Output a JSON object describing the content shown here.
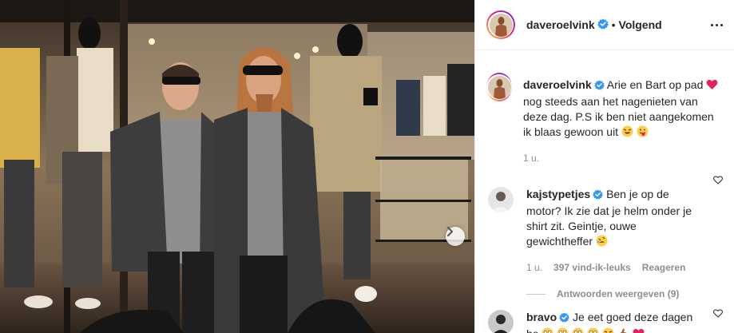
{
  "header": {
    "username": "daveroelvink",
    "separator": "•",
    "follow_label": "Volgend"
  },
  "caption": {
    "username": "daveroelvink",
    "text_part1": "Arie en Bart op pad",
    "text_part2": "nog steeds aan het nagenieten van deze dag. P.S ik ben niet aangekomen ik blaas gewoon uit",
    "time": "1 u."
  },
  "comments": [
    {
      "username": "kajstypetjes",
      "text": "Ben je op de motor? Ik zie dat je helm onder je shirt zit. Geintje, ouwe gewichtheffer",
      "time": "1 u.",
      "likes": "397 vind-ik-leuks",
      "reply_label": "Reageren",
      "view_replies": "Antwoorden weergeven (9)"
    },
    {
      "username": "bravo",
      "text": "Je eet goed deze dagen he"
    }
  ],
  "icons": {
    "verified": "verified-badge-icon",
    "more": "more-options-icon",
    "like": "heart-outline-icon",
    "next": "chevron-right-icon"
  },
  "colors": {
    "verified_blue": "#3897f0",
    "secondary_text": "#8e8e8e",
    "heart_red": "#ed4956"
  }
}
